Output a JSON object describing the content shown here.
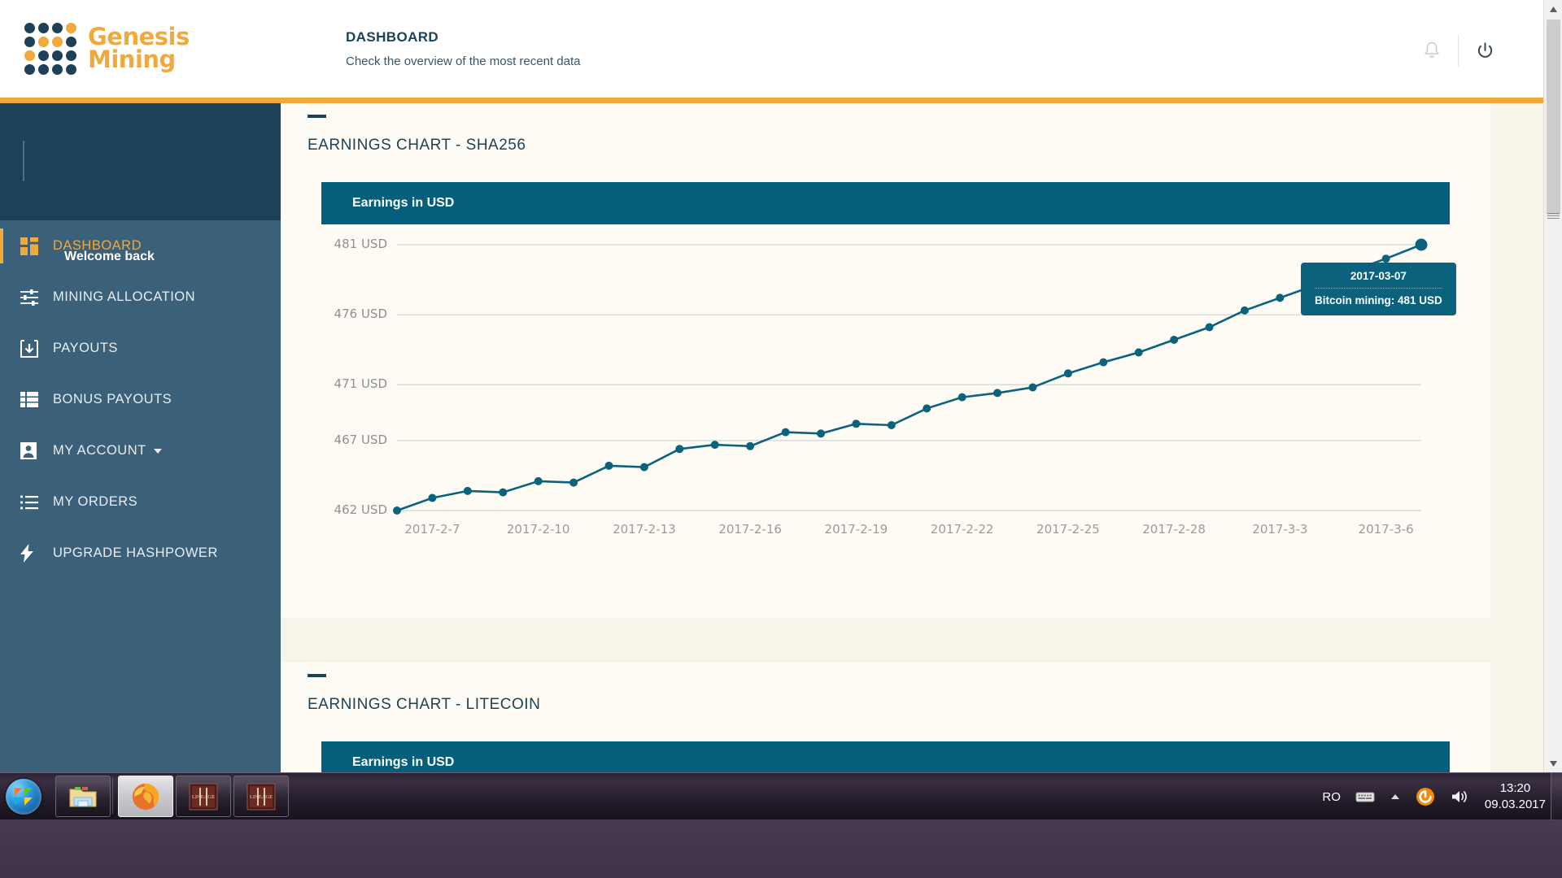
{
  "brand": {
    "name_line1": "Genesis",
    "name_line2": "Mining",
    "accent": "#f2a93b",
    "dark": "#1d4257",
    "logo_rows": [
      [
        "dark",
        "dark",
        "dark",
        "orange"
      ],
      [
        "dark",
        "orange",
        "orange",
        "dark"
      ],
      [
        "orange",
        "dark",
        "dark",
        "dark"
      ],
      [
        "dark",
        "dark",
        "dark",
        "dark"
      ]
    ]
  },
  "header": {
    "title": "DASHBOARD",
    "subtitle": "Check the overview of the most recent data",
    "bell_icon": "notification-bell-icon",
    "power_icon": "power-icon"
  },
  "sidebar": {
    "welcome": "Welcome back",
    "items": [
      {
        "label": "DASHBOARD",
        "icon": "dashboard-grid-icon",
        "active": true,
        "has_caret": false
      },
      {
        "label": "MINING ALLOCATION",
        "icon": "sliders-icon",
        "active": false,
        "has_caret": false
      },
      {
        "label": "PAYOUTS",
        "icon": "download-box-icon",
        "active": false,
        "has_caret": false
      },
      {
        "label": "BONUS PAYOUTS",
        "icon": "list-icon",
        "active": false,
        "has_caret": false
      },
      {
        "label": "MY ACCOUNT",
        "icon": "user-icon",
        "active": false,
        "has_caret": true
      },
      {
        "label": "MY ORDERS",
        "icon": "bullet-list-icon",
        "active": false,
        "has_caret": false
      },
      {
        "label": "UPGRADE HASHPOWER",
        "icon": "lightning-bolt-icon",
        "active": false,
        "has_caret": false
      }
    ]
  },
  "main": {
    "card1": {
      "title": "EARNINGS CHART - SHA256",
      "chart_header": "Earnings in USD"
    },
    "card2": {
      "title": "EARNINGS CHART - LITECOIN",
      "chart_header": "Earnings in USD"
    }
  },
  "tooltip": {
    "date": "2017-03-07",
    "value": "Bitcoin mining: 481 USD"
  },
  "chart_data": {
    "type": "line",
    "title": "EARNINGS CHART - SHA256",
    "subtitle": "Earnings in USD",
    "xlabel": "",
    "ylabel": "USD",
    "series_name": "Bitcoin mining",
    "line_color": "#0b627c",
    "grid": true,
    "legend": "none",
    "ylim": [
      462,
      481
    ],
    "ytick_labels": [
      "481 USD",
      "476 USD",
      "471 USD",
      "467 USD",
      "462 USD"
    ],
    "yticks": [
      481,
      476,
      471,
      467,
      462
    ],
    "xtick_labels": [
      "2017-2-7",
      "2017-2-10",
      "2017-2-13",
      "2017-2-16",
      "2017-2-19",
      "2017-2-22",
      "2017-2-25",
      "2017-2-28",
      "2017-3-3",
      "2017-3-6"
    ],
    "x": [
      "2017-02-06",
      "2017-02-07",
      "2017-02-08",
      "2017-02-09",
      "2017-02-10",
      "2017-02-11",
      "2017-02-12",
      "2017-02-13",
      "2017-02-14",
      "2017-02-15",
      "2017-02-16",
      "2017-02-17",
      "2017-02-18",
      "2017-02-19",
      "2017-02-20",
      "2017-02-21",
      "2017-02-22",
      "2017-02-23",
      "2017-02-24",
      "2017-02-25",
      "2017-02-26",
      "2017-02-27",
      "2017-02-28",
      "2017-03-01",
      "2017-03-02",
      "2017-03-03",
      "2017-03-04",
      "2017-03-05",
      "2017-03-06",
      "2017-03-07"
    ],
    "values": [
      462.0,
      462.9,
      463.4,
      463.3,
      464.1,
      464.0,
      465.2,
      465.1,
      466.4,
      466.7,
      466.6,
      467.6,
      467.5,
      468.2,
      468.1,
      469.3,
      470.1,
      470.4,
      470.8,
      471.8,
      472.6,
      473.3,
      474.2,
      475.1,
      476.3,
      477.2,
      478.1,
      479.1,
      480.0,
      481.0
    ],
    "highlight_point": {
      "x": "2017-03-07",
      "y": 481,
      "label": "Bitcoin mining: 481 USD"
    }
  },
  "scrollbar": {
    "up_arrow": "scroll-up-arrow-icon",
    "down_arrow": "scroll-down-arrow-icon"
  },
  "taskbar": {
    "start_label": "start-orb",
    "buttons": [
      {
        "name": "windows-explorer",
        "icon": "folder-icon",
        "active": false
      },
      {
        "name": "firefox",
        "icon": "firefox-icon",
        "active": true
      },
      {
        "name": "lineage-2-a",
        "icon": "lineage2-icon",
        "active": false
      },
      {
        "name": "lineage-2-b",
        "icon": "lineage2-icon",
        "active": false
      }
    ],
    "tray": {
      "language": "RO",
      "keyboard_icon": "keyboard-icon",
      "expand_icon": "show-hidden-icons-icon",
      "app_icon": "orange-circle-app-icon",
      "volume_icon": "speaker-icon",
      "time": "13:20",
      "date": "09.03.2017"
    }
  }
}
